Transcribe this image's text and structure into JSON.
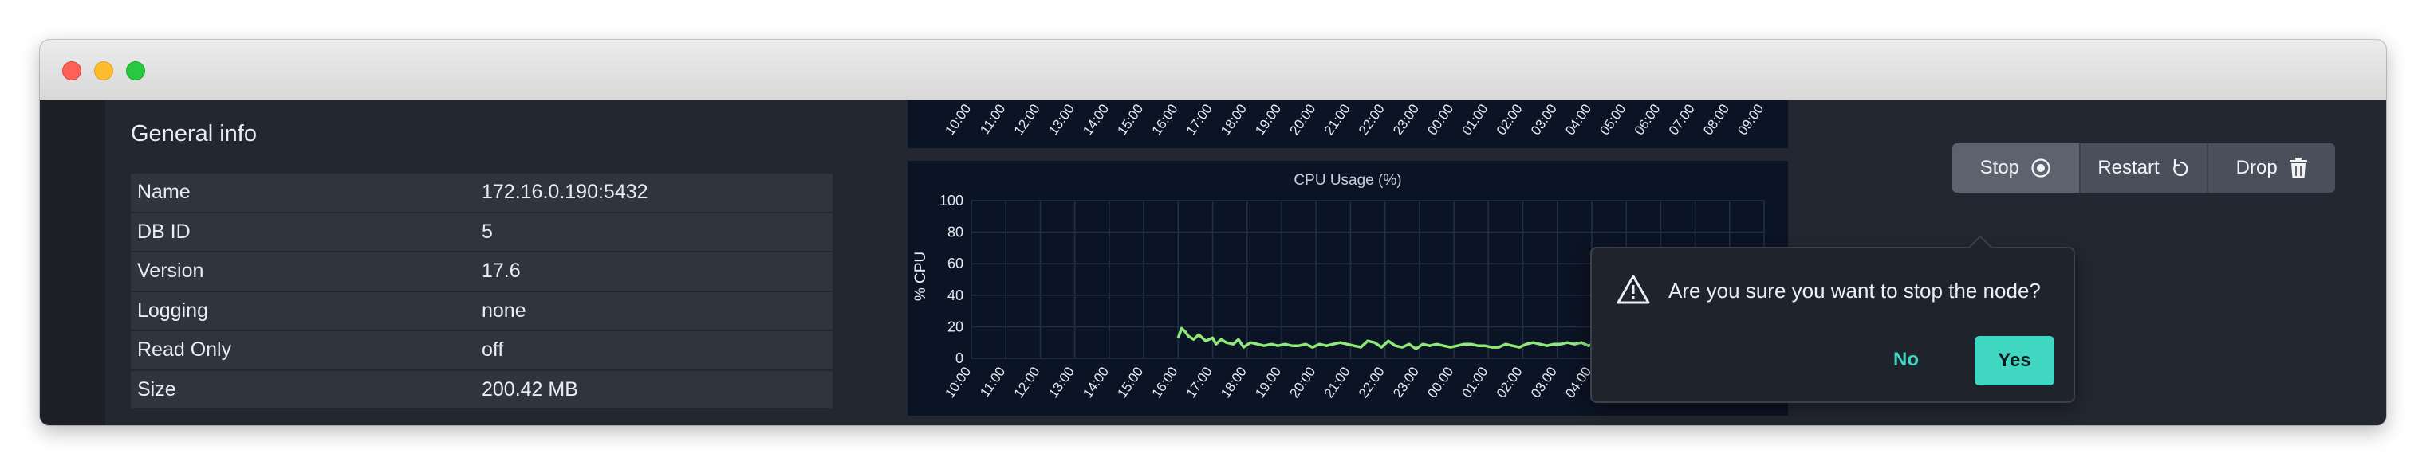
{
  "general": {
    "title": "General info",
    "rows": [
      {
        "label": "Name",
        "value": "172.16.0.190:5432"
      },
      {
        "label": "DB ID",
        "value": "5"
      },
      {
        "label": "Version",
        "value": "17.6"
      },
      {
        "label": "Logging",
        "value": "none"
      },
      {
        "label": "Read Only",
        "value": "off"
      },
      {
        "label": "Size",
        "value": "200.42 MB"
      }
    ]
  },
  "toolbar": {
    "stop_label": "Stop",
    "restart_label": "Restart",
    "drop_label": "Drop"
  },
  "confirm": {
    "message": "Are you sure you want to stop the node?",
    "no_label": "No",
    "yes_label": "Yes"
  },
  "colors": {
    "accent": "#3fd6c2",
    "series": "#8ee87a"
  },
  "chart_data": {
    "type": "line",
    "title": "CPU Usage (%)",
    "ylabel": "% CPU",
    "xlabel": "",
    "ylim": [
      0,
      100
    ],
    "yticks": [
      0,
      20,
      40,
      60,
      80,
      100
    ],
    "xticks": [
      "10:00",
      "11:00",
      "12:00",
      "13:00",
      "14:00",
      "15:00",
      "16:00",
      "17:00",
      "18:00",
      "19:00",
      "20:00",
      "21:00",
      "22:00",
      "23:00",
      "00:00",
      "01:00",
      "02:00",
      "03:00",
      "04:00",
      "05:00",
      "06:00",
      "07:00",
      "08:00",
      "09:00"
    ],
    "grid": true,
    "series": [
      {
        "x": [
          6.0,
          6.1,
          6.2,
          6.3,
          6.45,
          6.6,
          6.8,
          7.0,
          7.1,
          7.25,
          7.4,
          7.6,
          7.75,
          7.9,
          8.1,
          8.3,
          8.5,
          8.7,
          8.9,
          9.1,
          9.3,
          9.5,
          9.7,
          9.9,
          10.1,
          10.3,
          10.5,
          10.7,
          10.9,
          11.1,
          11.3,
          11.5,
          11.7,
          11.9,
          12.1,
          12.3,
          12.5,
          12.7,
          12.9,
          13.1,
          13.3,
          13.5,
          13.7,
          13.9,
          14.1,
          14.3,
          14.5,
          14.7,
          14.9,
          15.1,
          15.3,
          15.5,
          15.7,
          15.9,
          16.1,
          16.3,
          16.5,
          16.7,
          16.9,
          17.1,
          17.3,
          17.5,
          17.7,
          17.9,
          18.0
        ],
        "y": [
          13,
          19,
          17,
          14,
          12,
          15,
          11,
          13,
          9,
          12,
          10,
          9,
          12,
          7,
          10,
          9,
          8,
          9,
          8,
          9,
          8,
          8,
          9,
          7,
          9,
          8,
          9,
          10,
          9,
          8,
          7,
          11,
          10,
          7,
          11,
          8,
          7,
          9,
          6,
          9,
          8,
          9,
          8,
          7,
          8,
          9,
          9,
          8,
          8,
          7,
          7,
          9,
          8,
          7,
          9,
          10,
          9,
          8,
          9,
          9,
          10,
          9,
          10,
          8,
          9
        ]
      }
    ]
  }
}
